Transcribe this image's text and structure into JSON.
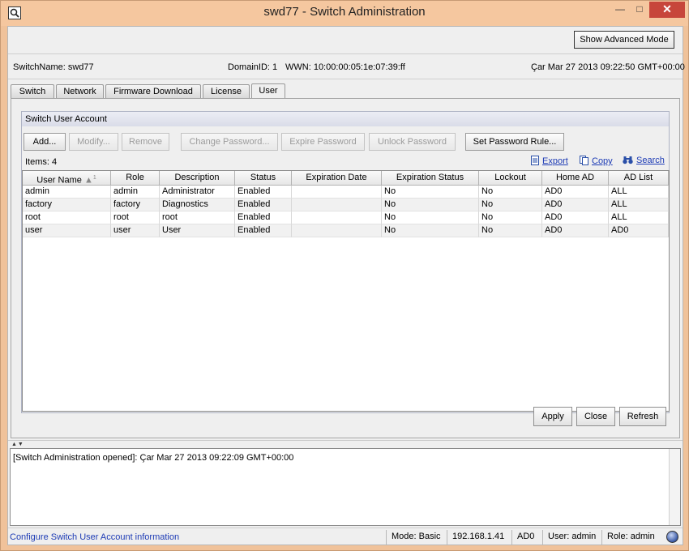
{
  "window": {
    "title": "swd77 - Switch Administration",
    "controls": {
      "minimize": "—",
      "maximize": "□",
      "close": "✕"
    }
  },
  "toolbar": {
    "advanced_mode_label": "Show Advanced Mode"
  },
  "info": {
    "switch_name": "SwitchName: swd77",
    "domain_id": "DomainID: 1",
    "wwn": "WWN: 10:00:00:05:1e:07:39:ff",
    "datetime": "Çar Mar 27 2013 09:22:50 GMT+00:00"
  },
  "tabs": [
    {
      "label": "Switch"
    },
    {
      "label": "Network"
    },
    {
      "label": "Firmware Download"
    },
    {
      "label": "License"
    },
    {
      "label": "User",
      "active": true
    }
  ],
  "panel": {
    "group_title": "Switch User Account",
    "buttons": {
      "add": "Add...",
      "modify": "Modify...",
      "remove": "Remove",
      "change_password": "Change Password...",
      "expire_password": "Expire Password",
      "unlock_password": "Unlock Password",
      "set_password_rule": "Set Password Rule..."
    },
    "items_count": "Items: 4",
    "links": {
      "export": "Export",
      "copy": "Copy",
      "search": "Search"
    },
    "sort_indicator": "▲",
    "sort_index": "1",
    "columns": [
      "User Name",
      "Role",
      "Description",
      "Status",
      "Expiration Date",
      "Expiration Status",
      "Lockout",
      "Home AD",
      "AD List"
    ],
    "rows": [
      [
        "admin",
        "admin",
        "Administrator",
        "Enabled",
        "",
        "No",
        "No",
        "AD0",
        "ALL"
      ],
      [
        "factory",
        "factory",
        "Diagnostics",
        "Enabled",
        "",
        "No",
        "No",
        "AD0",
        "ALL"
      ],
      [
        "root",
        "root",
        "root",
        "Enabled",
        "",
        "No",
        "No",
        "AD0",
        "ALL"
      ],
      [
        "user",
        "user",
        "User",
        "Enabled",
        "",
        "No",
        "No",
        "AD0",
        "AD0"
      ]
    ]
  },
  "actions": {
    "apply": "Apply",
    "close": "Close",
    "refresh": "Refresh"
  },
  "log": {
    "message": "[Switch Administration opened]: Çar Mar 27 2013 09:22:09 GMT+00:00"
  },
  "status": {
    "hint": "Configure Switch User Account information",
    "mode": "Mode: Basic",
    "ip": "192.168.1.41",
    "ad": "AD0",
    "user": "User: admin",
    "role": "Role: admin"
  }
}
